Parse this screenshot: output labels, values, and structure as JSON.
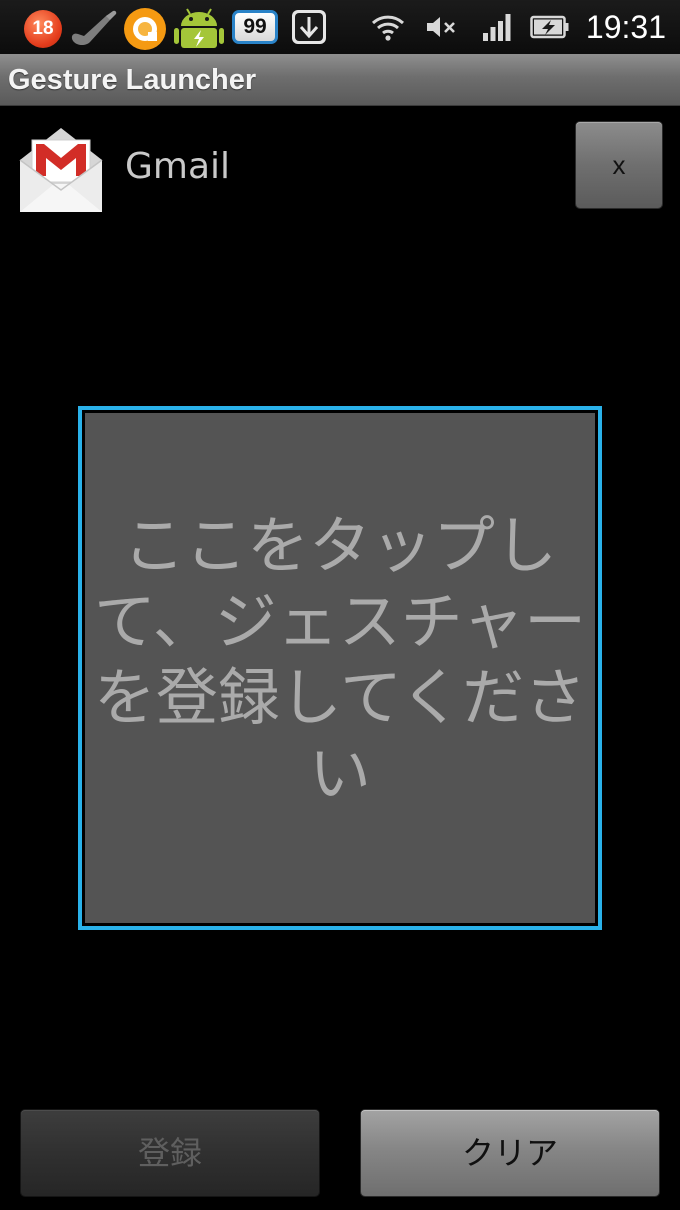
{
  "status_bar": {
    "notification_count": "18",
    "badge_count": "99",
    "time": "19:31",
    "icons": [
      "notification-count-icon",
      "phone-icon",
      "orange-ring-icon",
      "android-charging-icon",
      "count-badge-icon",
      "download-icon",
      "wifi-icon",
      "mute-icon",
      "signal-icon",
      "battery-charging-icon"
    ]
  },
  "title_bar": {
    "title": "Gesture Launcher"
  },
  "app": {
    "icon": "gmail-icon",
    "name": "Gmail",
    "close_label": "x"
  },
  "gesture_area": {
    "hint": "ここをタップして、ジェスチャーを登録してください",
    "border_color": "#2ab2ea"
  },
  "buttons": {
    "register_label": "登録",
    "clear_label": "クリア"
  }
}
